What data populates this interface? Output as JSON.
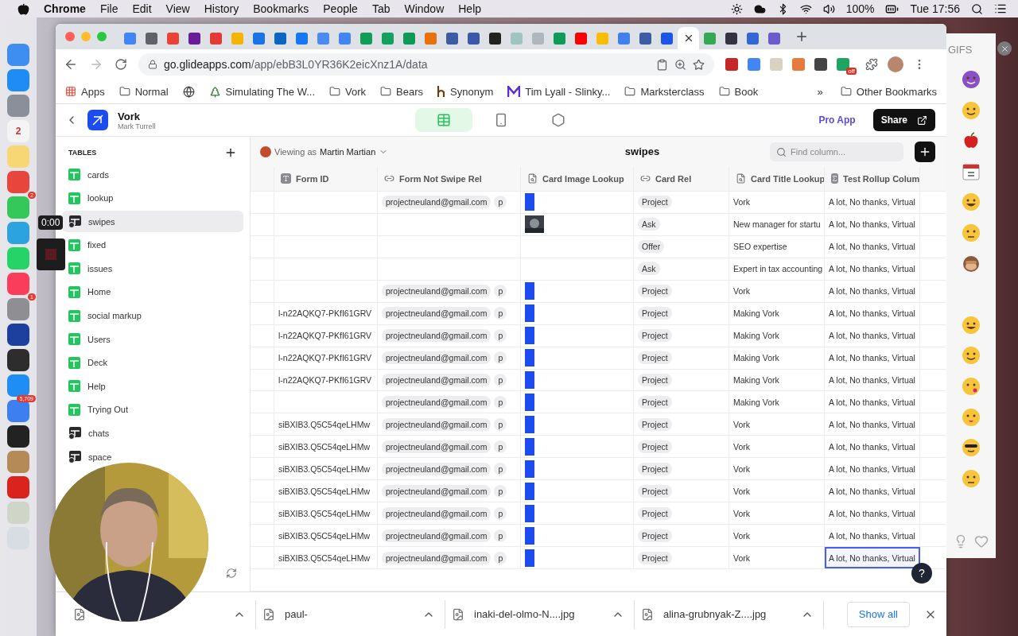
{
  "menu_bar": {
    "app": "Chrome",
    "items": [
      "File",
      "Edit",
      "View",
      "History",
      "Bookmarks",
      "People",
      "Tab",
      "Window",
      "Help"
    ],
    "battery": "100%",
    "clock": "Tue 17:56"
  },
  "dock": [
    {
      "color": "#3d8ef0"
    },
    {
      "color": "#1f8bf5"
    },
    {
      "color": "#8a8f99"
    },
    {
      "color": "#f4f4f4",
      "label": "2"
    },
    {
      "color": "#f7d774"
    },
    {
      "color": "#e8453c"
    },
    {
      "color": "#34c759",
      "badge": "2"
    },
    {
      "color": "#2aa3e0"
    },
    {
      "color": "#25d366"
    },
    {
      "color": "#fa3d5b"
    },
    {
      "color": "#8e8e93",
      "badge": "1"
    },
    {
      "color": "#1d3f9e"
    },
    {
      "color": "#2d2d2d"
    },
    {
      "color": "#1e8ef5"
    },
    {
      "color": "#3d7ef0",
      "badge": "5,709"
    },
    {
      "color": "#222222"
    },
    {
      "color": "#b58a56"
    },
    {
      "color": "#d9231c"
    },
    {
      "color": "#cfd6c8"
    },
    {
      "color": "#d8dde3"
    }
  ],
  "recorder": {
    "time": "0:00"
  },
  "browser": {
    "tabs": [
      {
        "color": "#4285f4",
        "selected": false
      },
      {
        "color": "#5f6368",
        "selected": false
      },
      {
        "color": "#ea4335",
        "selected": false
      },
      {
        "color": "#6a1b9a",
        "selected": false
      },
      {
        "color": "#e53935",
        "selected": false
      },
      {
        "color": "#f4b400",
        "selected": false
      },
      {
        "color": "#1a73e8",
        "selected": false
      },
      {
        "color": "#0a66c2",
        "selected": false
      },
      {
        "color": "#1877f2",
        "selected": false
      },
      {
        "color": "#4a8af4",
        "selected": false
      },
      {
        "color": "#4285f4",
        "selected": false
      },
      {
        "color": "#0f9d58",
        "selected": false
      },
      {
        "color": "#12a15e",
        "selected": false
      },
      {
        "color": "#0c9a55",
        "selected": false
      },
      {
        "color": "#e8710a",
        "selected": false
      },
      {
        "color": "#3b5ba5",
        "selected": false
      },
      {
        "color": "#3a5aa8",
        "selected": false
      },
      {
        "color": "#222222",
        "selected": false
      },
      {
        "color": "#9ec5c0",
        "selected": false
      },
      {
        "color": "#b0b6be",
        "selected": false
      },
      {
        "color": "#0e9c57",
        "selected": false
      },
      {
        "color": "#ff0000",
        "selected": false
      },
      {
        "color": "#fbbc04",
        "selected": false
      },
      {
        "color": "#4080f0",
        "selected": false
      },
      {
        "color": "#3c5ca6",
        "selected": false
      },
      {
        "color": "#1a57e8",
        "selected": false
      },
      {
        "selected": true
      },
      {
        "color": "#34a853",
        "selected": false
      },
      {
        "color": "#333344",
        "selected": false
      },
      {
        "color": "#3367d6",
        "selected": false
      },
      {
        "color": "#6a5acd",
        "selected": false
      }
    ],
    "address": {
      "host": "go.glideapps.com",
      "path": "/app/ebB3L0YR36K2eicXnz1A/data"
    },
    "extension_badge": "off",
    "bookmarks": [
      {
        "kind": "apps",
        "label": "Apps"
      },
      {
        "kind": "folder",
        "label": "Normal"
      },
      {
        "kind": "globe"
      },
      {
        "kind": "tree",
        "label": "Simulating The W..."
      },
      {
        "kind": "folder",
        "label": "Vork"
      },
      {
        "kind": "folder",
        "label": "Bears"
      },
      {
        "kind": "h",
        "label": "Synonym"
      },
      {
        "kind": "m",
        "label": "Tim Lyall - Slinky..."
      },
      {
        "kind": "folder",
        "label": "Marksterclass"
      },
      {
        "kind": "folder",
        "label": "Book"
      }
    ],
    "bookmarks_more": "»",
    "other_bookmarks": "Other Bookmarks"
  },
  "app": {
    "name": "Vork",
    "owner": "Mark Turrell",
    "views": [
      {
        "kind": "data",
        "selected": true
      },
      {
        "kind": "phone",
        "selected": false
      },
      {
        "kind": "settings",
        "selected": false
      }
    ],
    "pro_link": "Pro App",
    "share": "Share"
  },
  "sidebar": {
    "heading": "TABLES",
    "tables": [
      {
        "name": "cards",
        "kind": "sheet",
        "selected": false
      },
      {
        "name": "lookup",
        "kind": "sheet",
        "selected": false
      },
      {
        "name": "swipes",
        "kind": "sync",
        "selected": true
      },
      {
        "name": "fixed",
        "kind": "sheet",
        "selected": false
      },
      {
        "name": "issues",
        "kind": "sheet",
        "selected": false
      },
      {
        "name": "Home",
        "kind": "sheet",
        "selected": false
      },
      {
        "name": "social markup",
        "kind": "sheet",
        "selected": false
      },
      {
        "name": "Users",
        "kind": "sheet",
        "selected": false
      },
      {
        "name": "Deck",
        "kind": "sheet",
        "selected": false
      },
      {
        "name": "Help",
        "kind": "sheet",
        "selected": false
      },
      {
        "name": "Trying Out",
        "kind": "sheet",
        "selected": false
      },
      {
        "name": "chats",
        "kind": "sync",
        "selected": false
      },
      {
        "name": "space",
        "kind": "sync",
        "selected": false
      }
    ]
  },
  "grid": {
    "help": "?",
    "viewer_label": "Viewing as",
    "viewer": "Martin Martian",
    "title": "swipes",
    "search": {
      "placeholder": "Find column..."
    },
    "columns": [
      {
        "kind": "text",
        "label": "Form ID"
      },
      {
        "kind": "relation",
        "label": "Form Not Swipe Rel"
      },
      {
        "kind": "lookup",
        "label": "Card Image Lookup"
      },
      {
        "kind": "relation",
        "label": "Card Rel"
      },
      {
        "kind": "lookup",
        "label": "Card Title Lookup"
      },
      {
        "kind": "rollup",
        "label": "Test Rollup Colum"
      }
    ],
    "rows": [
      {
        "relations": [
          "projectneuland@gmail.com",
          "p"
        ],
        "thumbnail": {
          "kind": "icon"
        },
        "card_rel": "Project",
        "title": "Vork",
        "rollup": "A lot, No thanks, Virtual",
        "selected": false
      },
      {
        "card_rel": "Ask",
        "title": "New manager for startu",
        "rollup": "A lot, No thanks, Virtual",
        "selected": false
      },
      {
        "card_rel": "Offer",
        "title": "SEO expertise",
        "rollup": "A lot, No thanks, Virtual",
        "selected": false
      },
      {
        "card_rel": "Ask",
        "title": "Expert in tax accounting",
        "rollup": "A lot, No thanks, Virtual",
        "selected": false
      },
      {
        "relations": [
          "projectneuland@gmail.com",
          "p"
        ],
        "thumbnail": {
          "kind": "icon"
        },
        "card_rel": "Project",
        "title": "Vork",
        "rollup": "A lot, No thanks, Virtual",
        "selected": false
      },
      {
        "form_id": "l-n22AQKQ7-PKfI61GRV",
        "relations": [
          "projectneuland@gmail.com",
          "p"
        ],
        "thumbnail": {
          "kind": "icon"
        },
        "card_rel": "Project",
        "title": "Making Vork",
        "rollup": "A lot, No thanks, Virtual",
        "selected": false
      },
      {
        "form_id": "l-n22AQKQ7-PKfI61GRV",
        "relations": [
          "projectneuland@gmail.com",
          "p"
        ],
        "thumbnail": {
          "kind": "icon"
        },
        "card_rel": "Project",
        "title": "Making Vork",
        "rollup": "A lot, No thanks, Virtual",
        "selected": false
      },
      {
        "form_id": "l-n22AQKQ7-PKfI61GRV",
        "relations": [
          "projectneuland@gmail.com",
          "p"
        ],
        "thumbnail": {
          "kind": "icon"
        },
        "card_rel": "Project",
        "title": "Making Vork",
        "rollup": "A lot, No thanks, Virtual",
        "selected": false
      },
      {
        "form_id": "l-n22AQKQ7-PKfI61GRV",
        "relations": [
          "projectneuland@gmail.com",
          "p"
        ],
        "thumbnail": {
          "kind": "icon"
        },
        "card_rel": "Project",
        "title": "Making Vork",
        "rollup": "A lot, No thanks, Virtual",
        "selected": false
      },
      {
        "relations": [
          "projectneuland@gmail.com",
          "p"
        ],
        "thumbnail": {
          "kind": "icon"
        },
        "card_rel": "Project",
        "title": "Making Vork",
        "rollup": "A lot, No thanks, Virtual",
        "selected": false
      },
      {
        "form_id": "siBXIB3.Q5C54qeLHMw",
        "relations": [
          "projectneuland@gmail.com",
          "p"
        ],
        "thumbnail": {
          "kind": "icon"
        },
        "card_rel": "Project",
        "title": "Vork",
        "rollup": "A lot, No thanks, Virtual",
        "selected": false
      },
      {
        "form_id": "siBXIB3.Q5C54qeLHMw",
        "relations": [
          "projectneuland@gmail.com",
          "p"
        ],
        "thumbnail": {
          "kind": "icon"
        },
        "card_rel": "Project",
        "title": "Vork",
        "rollup": "A lot, No thanks, Virtual",
        "selected": false
      },
      {
        "form_id": "siBXIB3.Q5C54qeLHMw",
        "relations": [
          "projectneuland@gmail.com",
          "p"
        ],
        "thumbnail": {
          "kind": "icon"
        },
        "card_rel": "Project",
        "title": "Vork",
        "rollup": "A lot, No thanks, Virtual",
        "selected": false
      },
      {
        "form_id": "siBXIB3.Q5C54qeLHMw",
        "relations": [
          "projectneuland@gmail.com",
          "p"
        ],
        "thumbnail": {
          "kind": "icon"
        },
        "card_rel": "Project",
        "title": "Vork",
        "rollup": "A lot, No thanks, Virtual",
        "selected": false
      },
      {
        "form_id": "siBXIB3.Q5C54qeLHMw",
        "relations": [
          "projectneuland@gmail.com",
          "p"
        ],
        "thumbnail": {
          "kind": "icon"
        },
        "card_rel": "Project",
        "title": "Vork",
        "rollup": "A lot, No thanks, Virtual",
        "selected": false
      },
      {
        "form_id": "siBXIB3.Q5C54qeLHMw",
        "relations": [
          "projectneuland@gmail.com",
          "p"
        ],
        "thumbnail": {
          "kind": "icon"
        },
        "card_rel": "Project",
        "title": "Vork",
        "rollup": "A lot, No thanks, Virtual",
        "selected": false
      },
      {
        "form_id": "siBXIB3.Q5C54qeLHMw",
        "relations": [
          "projectneuland@gmail.com",
          "p"
        ],
        "thumbnail": {
          "kind": "icon"
        },
        "card_rel": "Project",
        "title": "Vork",
        "rollup": "A lot, No thanks, Virtual",
        "selected": true
      }
    ]
  },
  "downloads": {
    "items": [
      {
        "kind": "file"
      },
      {
        "kind": "file",
        "name": "paul-"
      },
      {
        "kind": "file",
        "name": "inaki-del-olmo-N....jpg"
      },
      {
        "kind": "file",
        "name": "alina-grubnyak-Z....jpg"
      }
    ],
    "show_all": "Show all"
  },
  "emoji_panel": {
    "heading": "GIFS",
    "emojis": [
      {
        "kind": "devil"
      },
      {
        "kind": "wink"
      },
      {
        "kind": "apple"
      },
      {
        "kind": "calendar"
      },
      {
        "kind": "laugh"
      },
      {
        "kind": "sad"
      },
      {
        "kind": "monkey"
      },
      {
        "kind": "gap"
      },
      {
        "kind": "sweat"
      },
      {
        "kind": "smile"
      },
      {
        "kind": "kiss"
      },
      {
        "kind": "squint"
      },
      {
        "kind": "cool"
      },
      {
        "kind": "sad"
      }
    ]
  }
}
